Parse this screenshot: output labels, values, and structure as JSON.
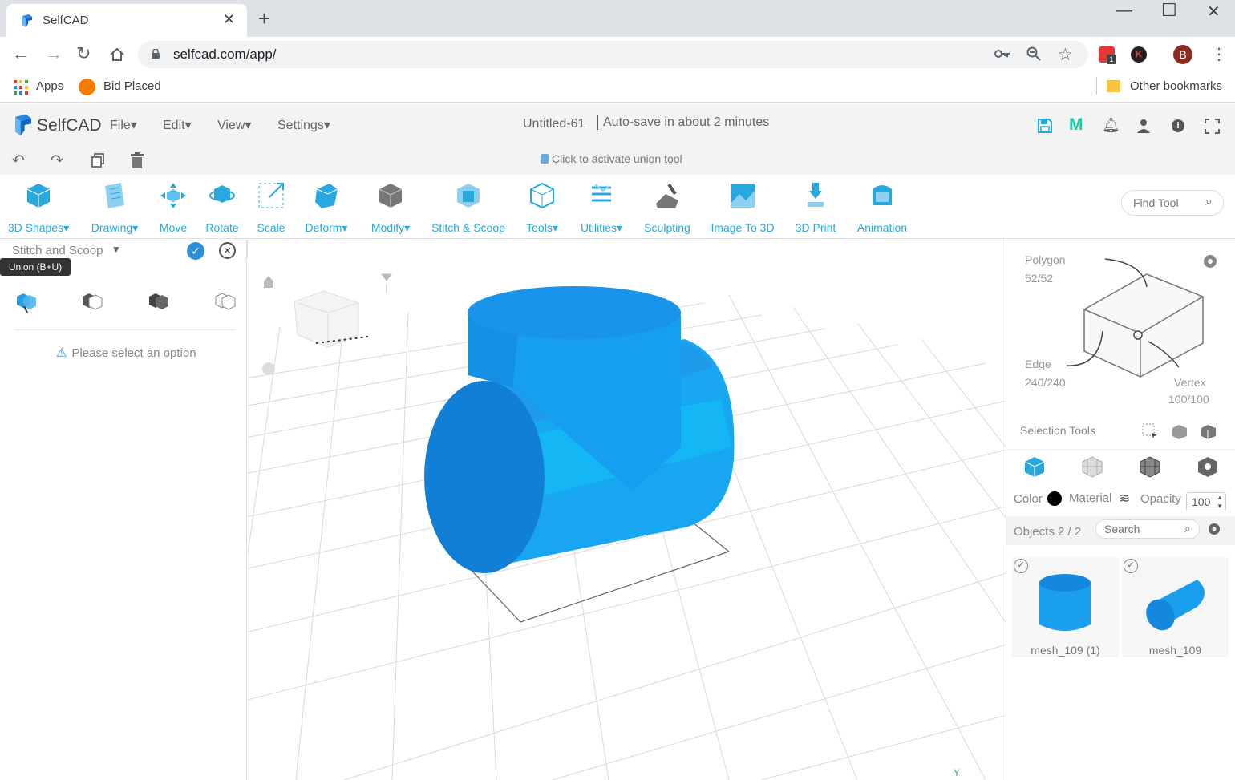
{
  "browser": {
    "tab_title": "SelfCAD",
    "tab_close": "✕",
    "new_tab": "+",
    "url": "selfcad.com/app/",
    "bookmarks": {
      "apps": "Apps",
      "bid": "Bid Placed",
      "other": "Other bookmarks"
    },
    "profile_initial": "B",
    "ext_initial": "K",
    "ext_badge": "1"
  },
  "app": {
    "logo": "SelfCAD",
    "menus": [
      "File",
      "Edit",
      "View",
      "Settings"
    ],
    "doc_title": "Untitled-61",
    "autosave": "Auto-save in about 2 minutes",
    "hint": "Click to activate union tool"
  },
  "toolbar": {
    "tools": [
      {
        "label": "3D Shapes▾",
        "icon": "cube-icon"
      },
      {
        "label": "Drawing▾",
        "icon": "drawing-icon"
      },
      {
        "label": "Move",
        "icon": "move-icon"
      },
      {
        "label": "Rotate",
        "icon": "rotate-icon"
      },
      {
        "label": "Scale",
        "icon": "scale-icon"
      },
      {
        "label": "Deform▾",
        "icon": "deform-icon"
      },
      {
        "label": "Modify▾",
        "icon": "modify-icon"
      },
      {
        "label": "Stitch & Scoop",
        "icon": "stitch-icon"
      },
      {
        "label": "Tools▾",
        "icon": "tools-icon"
      },
      {
        "label": "Utilities▾",
        "icon": "utilities-icon"
      },
      {
        "label": "Sculpting",
        "icon": "sculpting-icon"
      },
      {
        "label": "Image To 3D",
        "icon": "image-to-3d-icon"
      },
      {
        "label": "3D Print",
        "icon": "print-icon"
      },
      {
        "label": "Animation",
        "icon": "animation-icon"
      }
    ],
    "find_placeholder": "Find Tool",
    "accent": "#29a8e0"
  },
  "left_panel": {
    "title": "Stitch and Scoop",
    "tooltip": "Union (B+U)",
    "message": "Please select an option",
    "collapse": "<"
  },
  "right_panel": {
    "polygon_label": "Polygon",
    "polygon_count": "52/52",
    "edge_label": "Edge",
    "edge_count": "240/240",
    "vertex_label": "Vertex",
    "vertex_count": "100/100",
    "selection_tools": "Selection Tools",
    "color_label": "Color",
    "color_value": "#000000",
    "material_label": "Material",
    "opacity_label": "Opacity",
    "opacity_value": "100",
    "objects_label": "Objects 2 / 2",
    "search_placeholder": "Search",
    "objects": [
      {
        "name": "mesh_109 (1)",
        "icon": "cylinder-upright-icon"
      },
      {
        "name": "mesh_109",
        "icon": "cylinder-lying-icon"
      }
    ]
  },
  "viewport": {
    "axis_label": "Y",
    "mesh_color": "#1a9fef"
  }
}
